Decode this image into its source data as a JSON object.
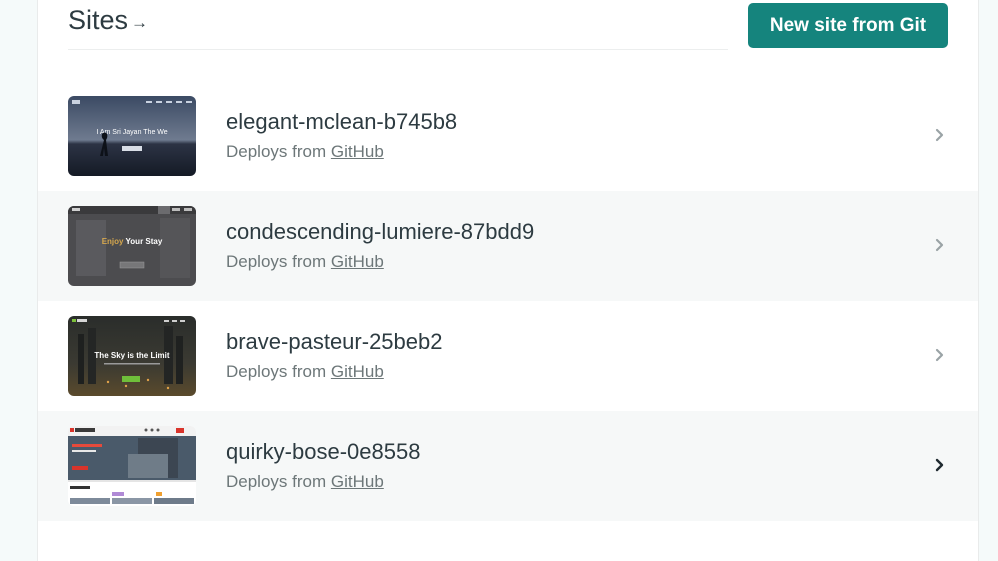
{
  "header": {
    "title": "Sites",
    "title_arrow": "→",
    "new_site_button": "New site from Git"
  },
  "sites": [
    {
      "name": "elegant-mclean-b745b8",
      "deploys_prefix": "Deploys from",
      "provider": "GitHub",
      "thumbnail_headline": "I Am Sri Jayan The We",
      "chevron_color": "#9aa3a6"
    },
    {
      "name": "condescending-lumiere-87bdd9",
      "deploys_prefix": "Deploys from",
      "provider": "GitHub",
      "thumbnail_headline_accent": "Enjoy",
      "thumbnail_headline": "Your Stay",
      "chevron_color": "#9aa3a6"
    },
    {
      "name": "brave-pasteur-25beb2",
      "deploys_prefix": "Deploys from",
      "provider": "GitHub",
      "thumbnail_headline": "The Sky is the Limit",
      "chevron_color": "#9aa3a6"
    },
    {
      "name": "quirky-bose-0e8558",
      "deploys_prefix": "Deploys from",
      "provider": "GitHub",
      "chevron_color": "#1f2a30"
    }
  ],
  "colors": {
    "accent": "#15847d",
    "page_background": "#f5fafa",
    "row_alt_background": "#f6f8f8"
  }
}
